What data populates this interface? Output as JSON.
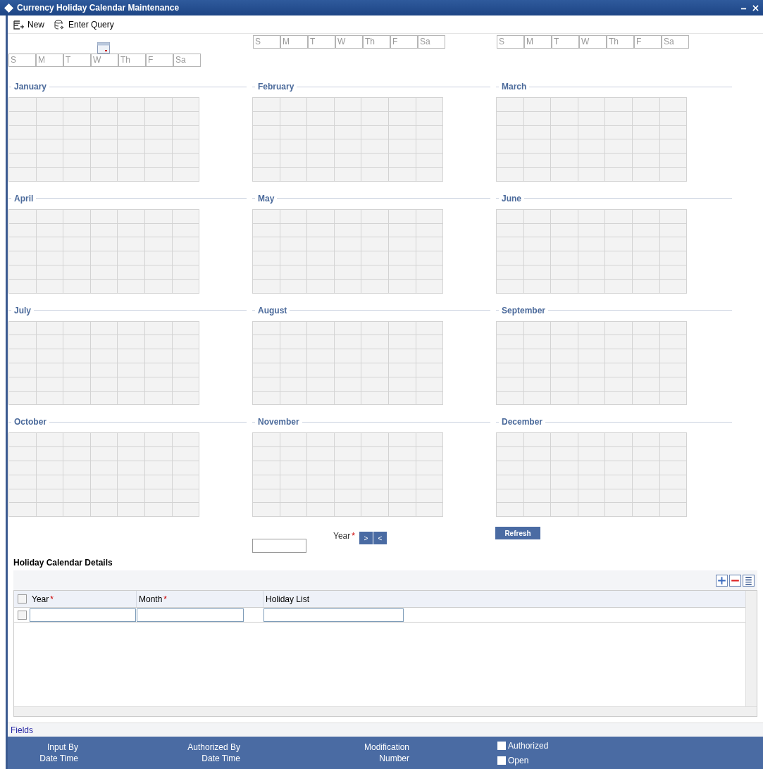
{
  "window": {
    "title": "Currency Holiday Calendar Maintenance"
  },
  "toolbar": [
    {
      "kind": "new",
      "label": "New"
    },
    {
      "kind": "query",
      "label": "Enter Query"
    }
  ],
  "day_header_rows": [
    {
      "picker": true,
      "days": [
        "S",
        "M",
        "T",
        "W",
        "Th",
        "F",
        "Sa"
      ]
    },
    {
      "picker": false,
      "days": [
        "S",
        "M",
        "T",
        "W",
        "Th",
        "F",
        "Sa"
      ]
    },
    {
      "picker": false,
      "days": [
        "S",
        "M",
        "T",
        "W",
        "Th",
        "F",
        "Sa"
      ]
    }
  ],
  "months": [
    "January",
    "February",
    "March",
    "April",
    "May",
    "June",
    "July",
    "August",
    "September",
    "October",
    "November",
    "December"
  ],
  "year": {
    "label": "Year",
    "required_mark": "*",
    "next": ">",
    "prev": "<"
  },
  "refresh": "Refresh",
  "details": {
    "title": "Holiday Calendar Details",
    "columns": [
      {
        "label": "Year",
        "required_mark": "*"
      },
      {
        "label": "Month",
        "required_mark": "*"
      },
      {
        "label": "Holiday List"
      }
    ],
    "rows": [
      {
        "checked": false
      }
    ],
    "header_checked": false
  },
  "fields_link": "Fields",
  "footer": [
    {
      "kind": "text",
      "lines": [
        "Input By",
        "Date Time"
      ]
    },
    {
      "kind": "text",
      "lines": [
        "Authorized By",
        "Date Time"
      ]
    },
    {
      "kind": "text",
      "lines": [
        "Modification",
        "Number"
      ]
    },
    {
      "kind": "checks",
      "items": [
        {
          "label": "Authorized",
          "checked": false
        },
        {
          "label": "Open",
          "checked": false
        }
      ]
    }
  ]
}
